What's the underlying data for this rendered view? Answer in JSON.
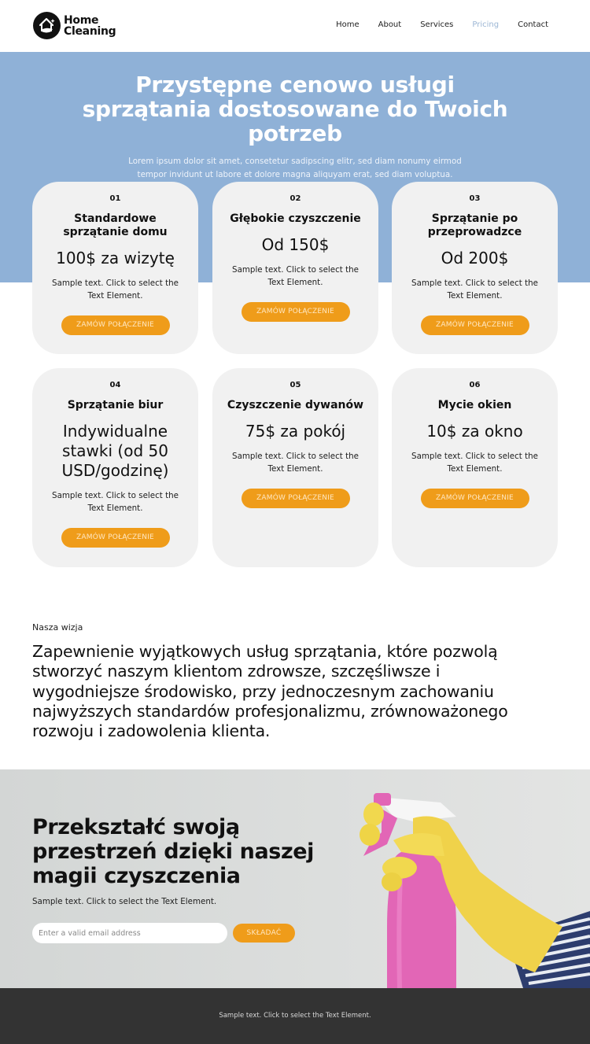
{
  "brand": {
    "name_line1": "Home",
    "name_line2": "Cleaning",
    "logo_icon": "house-with-sparkle-icon"
  },
  "nav": {
    "items": [
      {
        "label": "Home",
        "active": false
      },
      {
        "label": "About",
        "active": false
      },
      {
        "label": "Services",
        "active": false
      },
      {
        "label": "Pricing",
        "active": true
      },
      {
        "label": "Contact",
        "active": false
      }
    ]
  },
  "hero": {
    "title": "Przystępne cenowo usługi sprzątania dostosowane do Twoich potrzeb",
    "subtitle": "Lorem ipsum dolor sit amet, consetetur sadipscing elitr, sed diam nonumy eirmod tempor invidunt ut labore et dolore magna aliquyam erat, sed diam voluptua."
  },
  "cards": [
    {
      "number": "01",
      "title": "Standardowe sprzątanie domu",
      "price": "100$ za wizytę",
      "text": "Sample text. Click to select the Text Element.",
      "button": "ZAMÓW POŁĄCZENIE"
    },
    {
      "number": "02",
      "title": "Głębokie czyszczenie",
      "price": "Od 150$",
      "text": "Sample text. Click to select the Text Element.",
      "button": "ZAMÓW POŁĄCZENIE"
    },
    {
      "number": "03",
      "title": "Sprzątanie po przeprowadzce",
      "price": "Od 200$",
      "text": "Sample text. Click to select the Text Element.",
      "button": "ZAMÓW POŁĄCZENIE"
    },
    {
      "number": "04",
      "title": "Sprzątanie biur",
      "price": "Indywidualne stawki (od 50 USD/godzinę)",
      "text": "Sample text. Click to select the Text Element.",
      "button": "ZAMÓW POŁĄCZENIE"
    },
    {
      "number": "05",
      "title": "Czyszczenie dywanów",
      "price": "75$ za pokój",
      "text": "Sample text. Click to select the Text Element.",
      "button": "ZAMÓW POŁĄCZENIE"
    },
    {
      "number": "06",
      "title": "Mycie okien",
      "price": "10$ za okno",
      "text": "Sample text. Click to select the Text Element.",
      "button": "ZAMÓW POŁĄCZENIE"
    }
  ],
  "vision": {
    "label": "Nasza wizja",
    "text": "Zapewnienie wyjątkowych usług sprzątania, które pozwolą stworzyć naszym klientom zdrowsze, szczęśliwsze i wygodniejsze środowisko, przy jednoczesnym zachowaniu najwyższych standardów profesjonalizmu, zrównoważonego rozwoju i zadowolenia klienta."
  },
  "cta": {
    "title": "Przekształć swoją przestrzeń dzięki naszej magii czyszczenia",
    "text": "Sample text. Click to select the Text Element.",
    "email_placeholder": "Enter a valid email address",
    "email_value": "",
    "submit_label": "SKŁADAĆ",
    "image": "gloved-hand-holding-pink-spray-bottle"
  },
  "footer": {
    "text": "Sample text. Click to select the Text Element."
  },
  "colors": {
    "hero_bg": "#8fb1d7",
    "accent": "#ef9c1a",
    "card_bg": "#f1f1f1",
    "nav_active": "#9bb6d4",
    "footer_bg": "#333333"
  }
}
